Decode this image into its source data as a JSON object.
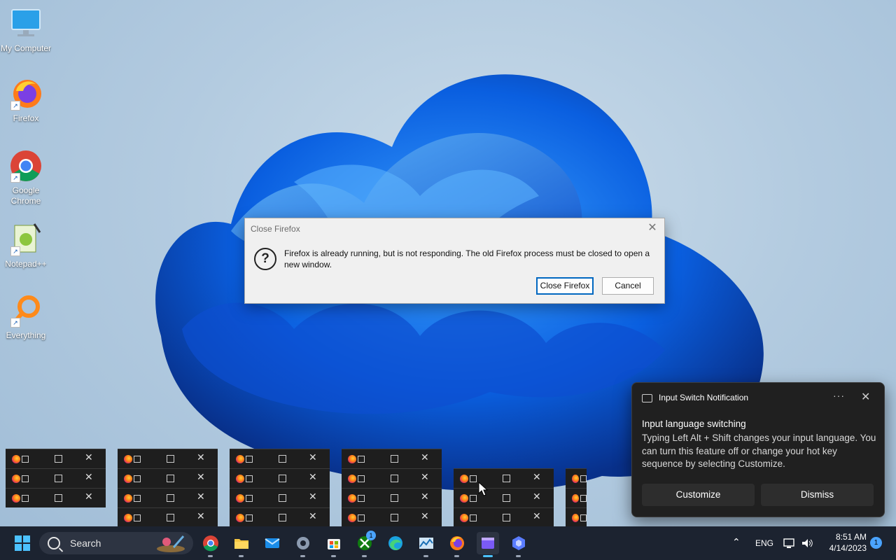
{
  "desktop": {
    "icons": [
      {
        "label": "My Computer"
      },
      {
        "label": "Firefox"
      },
      {
        "label": "Google Chrome"
      },
      {
        "label": "Notepad++"
      },
      {
        "label": "Everything"
      }
    ]
  },
  "dialog": {
    "title": "Close Firefox",
    "message": "Firefox is already running, but is not responding. The old Firefox process must be closed to open a new window.",
    "primary_button": "Close Firefox",
    "cancel_button": "Cancel",
    "close_glyph": "✕"
  },
  "notification": {
    "app_name": "Input Switch Notification",
    "more_glyph": "···",
    "close_glyph": "✕",
    "heading": "Input language switching",
    "body": "Typing Left Alt + Shift changes your input language. You can turn this feature off or change your hot key sequence by selecting Customize.",
    "customize_button": "Customize",
    "dismiss_button": "Dismiss"
  },
  "taskbar": {
    "search_placeholder": "Search",
    "apps": [
      "chrome-icon",
      "file-explorer-icon",
      "mail-icon",
      "settings-icon",
      "store-icon",
      "xbox-icon",
      "edge-icon",
      "stocks-icon",
      "firefox-icon",
      "clipchamp-icon",
      "copilot-icon"
    ],
    "xbox_badge": "1",
    "language": "ENG",
    "time": "8:51 AM",
    "date": "4/14/2023",
    "notification_count": "1",
    "colors": {
      "background": "#1c2330",
      "accent": "#0067c0"
    }
  }
}
